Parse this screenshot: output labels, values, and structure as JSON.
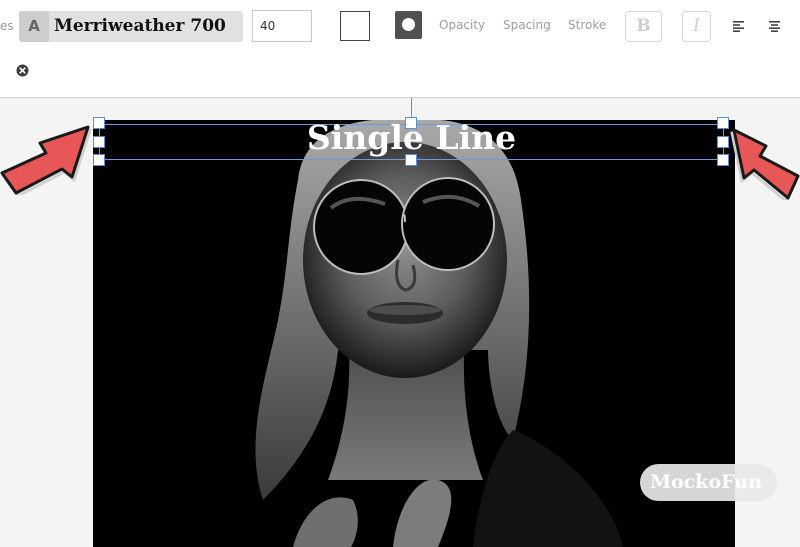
{
  "toolbar": {
    "cut_label": "es",
    "font_badge": "A",
    "font_name": "Merriweather 700",
    "font_size": "40",
    "text_color": "#ffffff",
    "stroke_color": "#505050",
    "labels": {
      "opacity": "Opacity",
      "spacing": "Spacing",
      "stroke": "Stroke"
    },
    "bold_label": "B",
    "italic_label": "I",
    "icons": {
      "align_left": "align-left-icon",
      "align_center": "align-center-icon",
      "clear": "close-circle-icon"
    }
  },
  "canvas": {
    "text": "Single Line",
    "watermark": "MockoFun",
    "arrow_color": "#e85757"
  }
}
